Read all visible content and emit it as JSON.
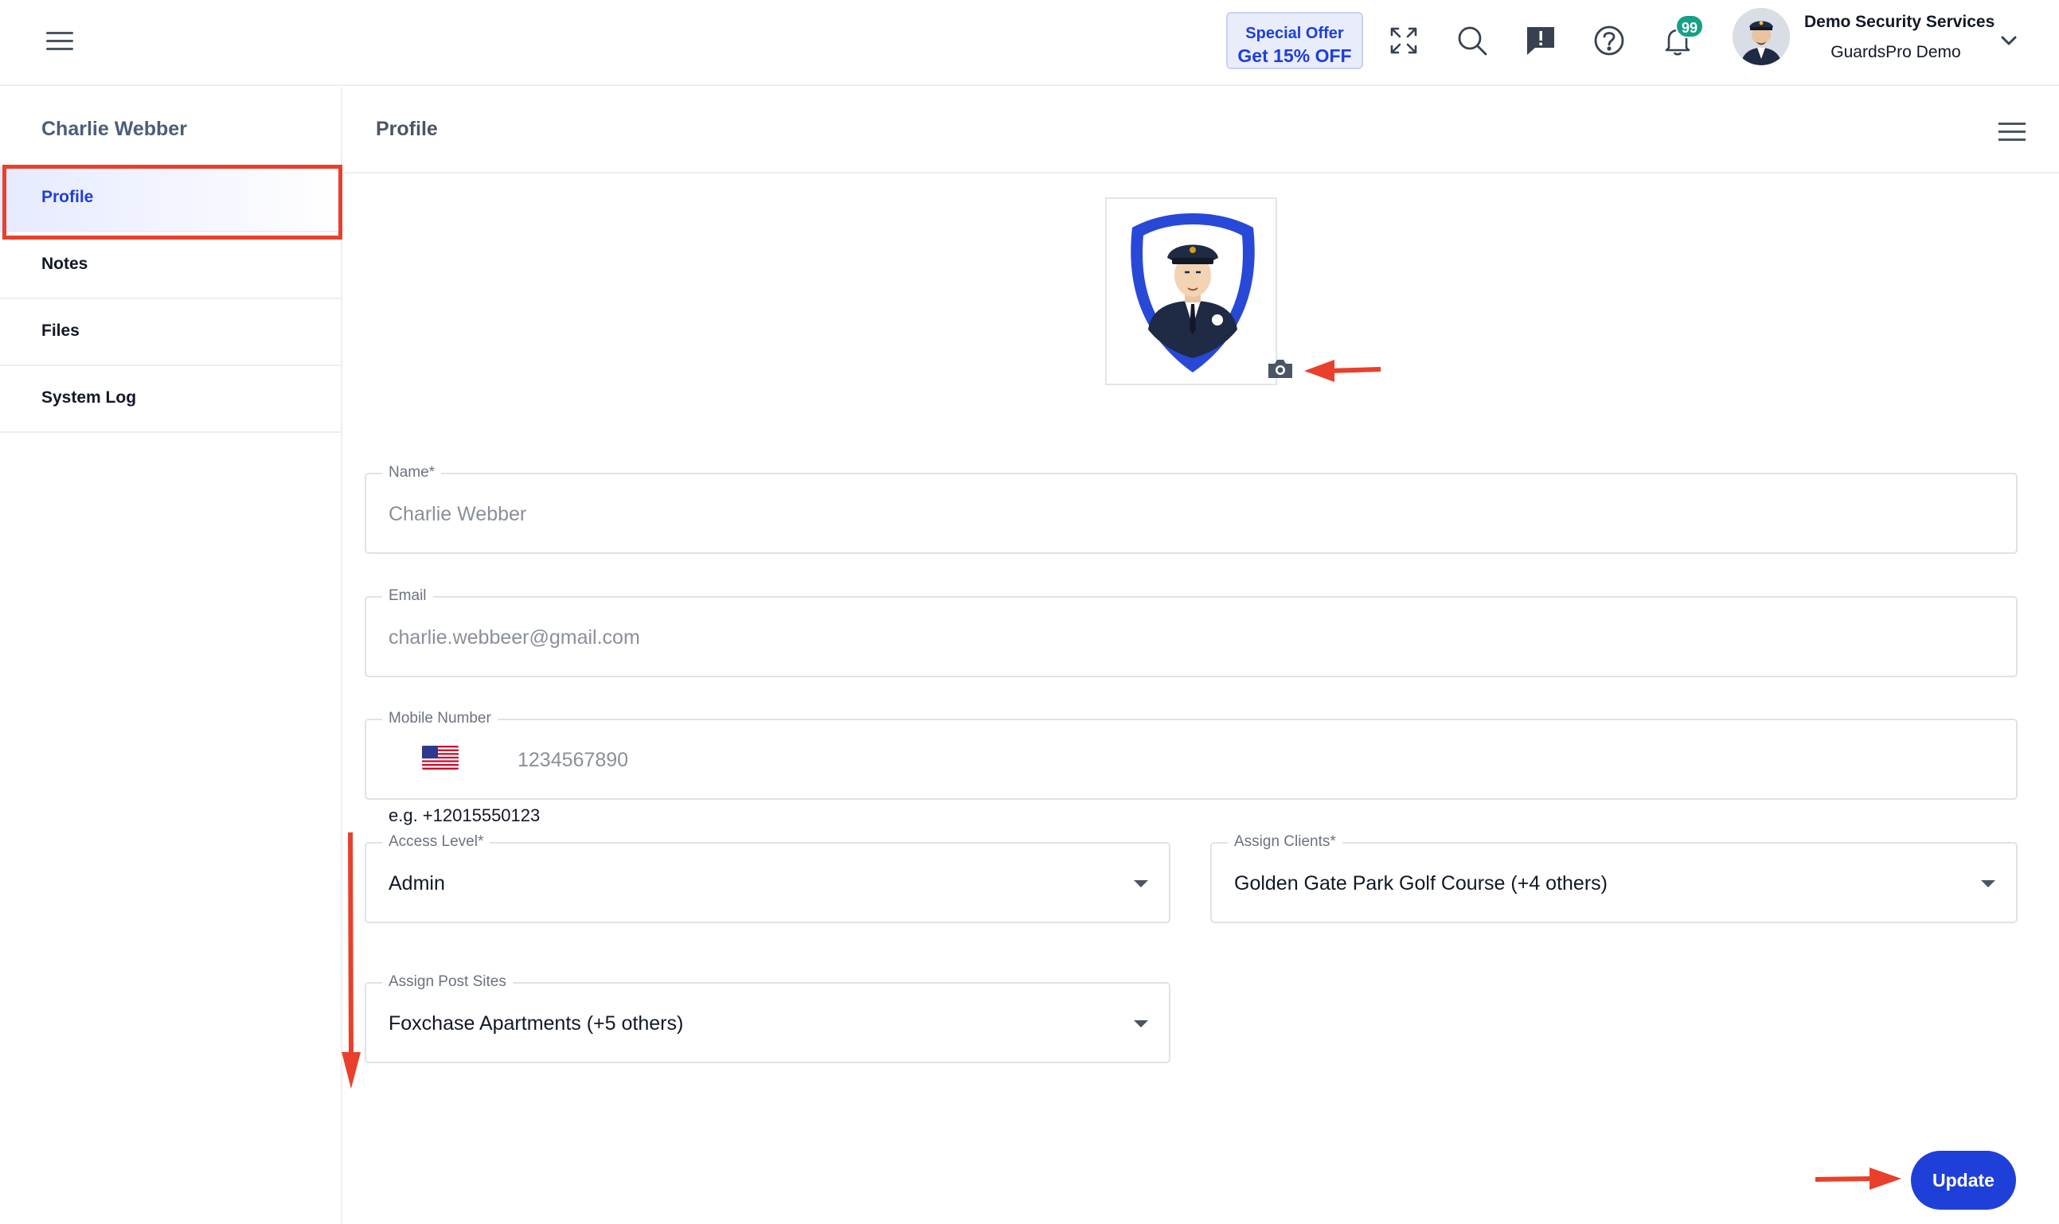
{
  "header": {
    "offer_line1": "Special Offer",
    "offer_line2": "Get 15% OFF",
    "notification_count": "99",
    "company_name": "Demo Security Services",
    "account_name": "GuardsPro Demo"
  },
  "sidebar": {
    "title": "Charlie Webber",
    "items": [
      {
        "label": "Profile",
        "active": true
      },
      {
        "label": "Notes",
        "active": false
      },
      {
        "label": "Files",
        "active": false
      },
      {
        "label": "System Log",
        "active": false
      }
    ]
  },
  "main": {
    "title": "Profile",
    "form": {
      "name_label": "Name*",
      "name_value": "Charlie Webber",
      "email_label": "Email",
      "email_value": "charlie.webbeer@gmail.com",
      "mobile_label": "Mobile Number",
      "mobile_value": "1234567890",
      "mobile_hint": "e.g. +12015550123",
      "access_label": "Access Level*",
      "access_value": "Admin",
      "clients_label": "Assign Clients*",
      "clients_value": "Golden Gate Park Golf Course (+4 others)",
      "postsites_label": "Assign Post Sites",
      "postsites_value": "Foxchase Apartments (+5 others)"
    },
    "update_label": "Update"
  },
  "colors": {
    "accent": "#1e3fd8",
    "annotation": "#e8402c",
    "badge": "#16a085"
  }
}
